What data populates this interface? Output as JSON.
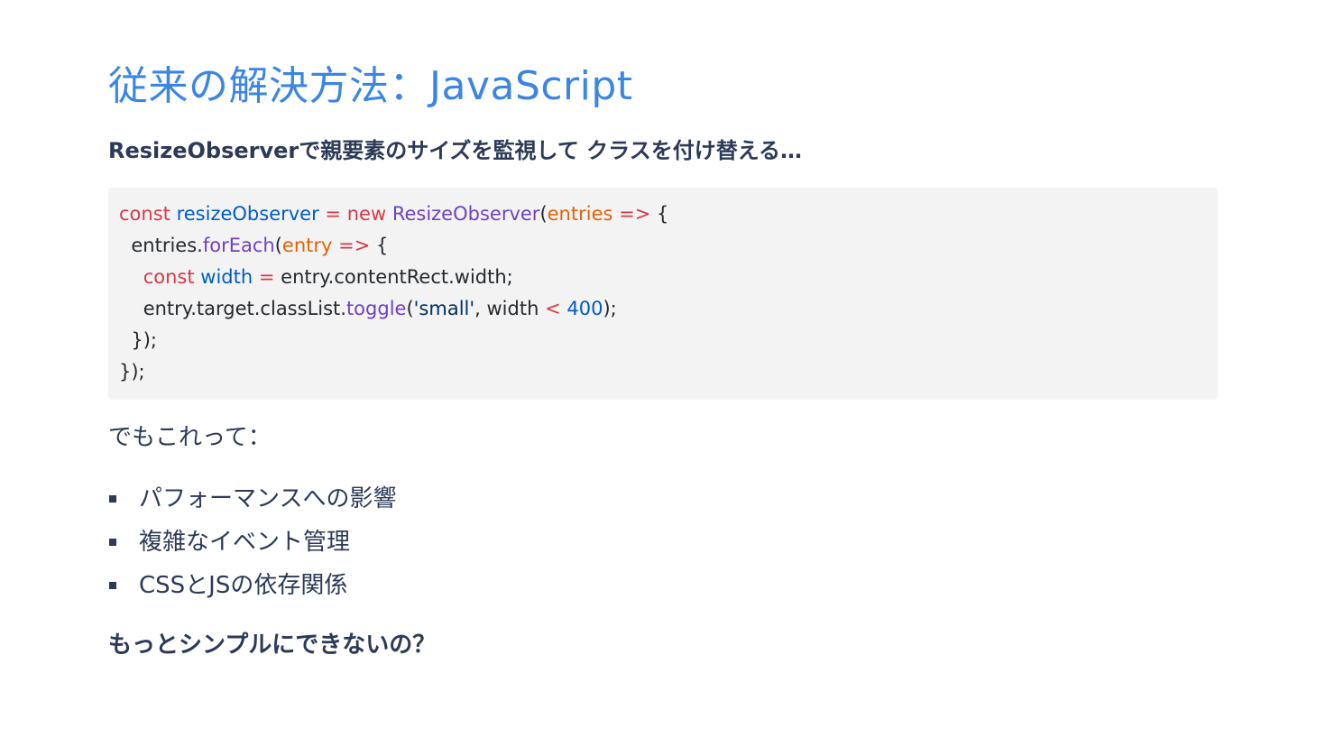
{
  "slide": {
    "title": "従来の解決方法：JavaScript",
    "subtitle": "ResizeObserverで親要素のサイズを監視して クラスを付け替える…",
    "code_lines": [
      [
        {
          "t": "const",
          "k": "kw"
        },
        {
          "t": " ",
          "k": "plain"
        },
        {
          "t": "resizeObserver",
          "k": "var"
        },
        {
          "t": " ",
          "k": "plain"
        },
        {
          "t": "=",
          "k": "kw"
        },
        {
          "t": " ",
          "k": "plain"
        },
        {
          "t": "new",
          "k": "kw"
        },
        {
          "t": " ",
          "k": "plain"
        },
        {
          "t": "ResizeObserver",
          "k": "fn"
        },
        {
          "t": "(",
          "k": "plain"
        },
        {
          "t": "entries",
          "k": "param"
        },
        {
          "t": " ",
          "k": "plain"
        },
        {
          "t": "=>",
          "k": "kw"
        },
        {
          "t": " {",
          "k": "plain"
        }
      ],
      [
        {
          "t": "  entries.",
          "k": "plain"
        },
        {
          "t": "forEach",
          "k": "fn"
        },
        {
          "t": "(",
          "k": "plain"
        },
        {
          "t": "entry",
          "k": "param"
        },
        {
          "t": " ",
          "k": "plain"
        },
        {
          "t": "=>",
          "k": "kw"
        },
        {
          "t": " {",
          "k": "plain"
        }
      ],
      [
        {
          "t": "    ",
          "k": "plain"
        },
        {
          "t": "const",
          "k": "kw"
        },
        {
          "t": " ",
          "k": "plain"
        },
        {
          "t": "width",
          "k": "var"
        },
        {
          "t": " ",
          "k": "plain"
        },
        {
          "t": "=",
          "k": "kw"
        },
        {
          "t": " entry.contentRect.width;",
          "k": "plain"
        }
      ],
      [
        {
          "t": "    entry.target.classList.",
          "k": "plain"
        },
        {
          "t": "toggle",
          "k": "fn"
        },
        {
          "t": "(",
          "k": "plain"
        },
        {
          "t": "'small'",
          "k": "str"
        },
        {
          "t": ", width ",
          "k": "plain"
        },
        {
          "t": "<",
          "k": "kw"
        },
        {
          "t": " ",
          "k": "plain"
        },
        {
          "t": "400",
          "k": "num"
        },
        {
          "t": ");",
          "k": "plain"
        }
      ],
      [
        {
          "t": "  });",
          "k": "plain"
        }
      ],
      [
        {
          "t": "});",
          "k": "plain"
        }
      ]
    ],
    "lead": "でもこれって：",
    "bullets": [
      "パフォーマンスへの影響",
      "複雑なイベント管理",
      "CSSとJSの依存関係"
    ],
    "closing": "もっとシンプルにできないの？"
  },
  "colors": {
    "title": "#3b86e3",
    "text": "#2c3a57",
    "code_background": "#f3f3f3",
    "keyword": "#d73a49",
    "variable": "#005cc5",
    "function": "#6f42c1",
    "parameter": "#e36209",
    "string": "#032f62",
    "number": "#005cc5"
  }
}
